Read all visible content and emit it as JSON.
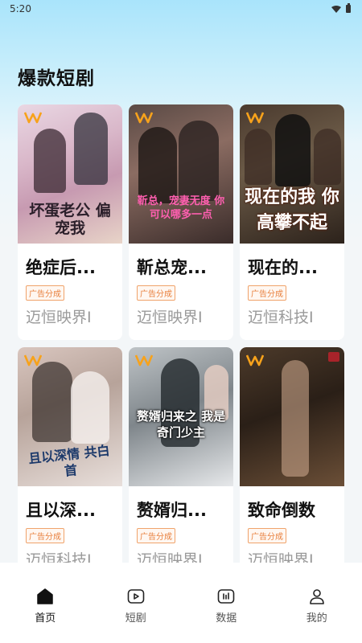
{
  "status_bar": {
    "time": "5:20"
  },
  "section": {
    "title": "爆款短剧"
  },
  "cards": [
    {
      "title": "绝症后...",
      "badge": "广告分成",
      "publisher": "迈恒映界I",
      "poster_text": "坏蛋老公 偏宠我"
    },
    {
      "title": "靳总宠...",
      "badge": "广告分成",
      "publisher": "迈恒映界I",
      "poster_text": "靳总，宠妻无度 你可以哪多一点"
    },
    {
      "title": "现在的...",
      "badge": "广告分成",
      "publisher": "迈恒科技I",
      "poster_text": "现在的我 你高攀不起"
    },
    {
      "title": "且以深...",
      "badge": "广告分成",
      "publisher": "迈恒科技I",
      "poster_text": "且以深情 共白首"
    },
    {
      "title": "赘婿归...",
      "badge": "广告分成",
      "publisher": "迈恒映界I",
      "poster_text": "赘婿归来之 我是奇门少主"
    },
    {
      "title": "致命倒数",
      "badge": "广告分成",
      "publisher": "迈恒映界I",
      "poster_text": ""
    }
  ],
  "tabs": [
    {
      "label": "首页",
      "icon": "home-icon",
      "active": true
    },
    {
      "label": "短剧",
      "icon": "play-icon",
      "active": false
    },
    {
      "label": "数据",
      "icon": "chart-icon",
      "active": false
    },
    {
      "label": "我的",
      "icon": "user-icon",
      "active": false
    }
  ],
  "colors": {
    "accent_orange": "#e8813f",
    "text_dark": "#111111",
    "text_gray": "#9a9a9a"
  }
}
